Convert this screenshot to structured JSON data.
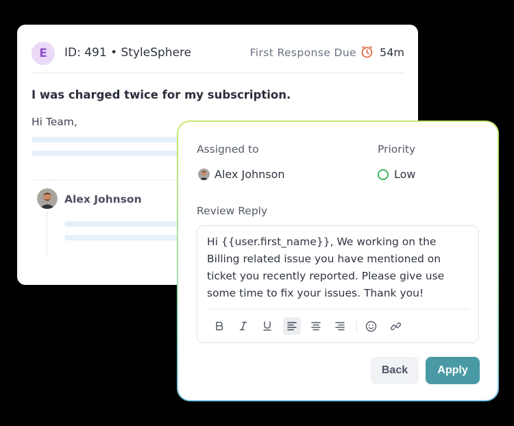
{
  "ticket": {
    "avatar_letter": "E",
    "id_label": "ID: 491 • StyleSphere",
    "first_response_label": "First Response Due",
    "first_response_time": "54m",
    "subject": "I was charged twice for my subscription.",
    "greeting": "Hi Team,",
    "reply_author": "Alex Johnson",
    "colors": {
      "avatar_bg": "#ead9f7",
      "avatar_fg": "#8e52c9",
      "timer": "#e0603a"
    }
  },
  "panel": {
    "assigned_label": "Assigned to",
    "assignee": "Alex Johnson",
    "priority_label": "Priority",
    "priority_value": "Low",
    "review_label": "Review Reply",
    "reply_text": "Hi {{user.first_name}}, We working on the Billing related issue you have mentioned on ticket you recently reported. Please give use some time to fix your issues. Thank you!",
    "toolbar": [
      "bold-icon",
      "italic-icon",
      "underline-icon",
      "align-left-icon",
      "align-center-icon",
      "align-right-icon",
      "emoji-icon",
      "link-icon"
    ],
    "active_tool": "align-left-icon",
    "back_label": "Back",
    "apply_label": "Apply",
    "colors": {
      "apply": "#4a9aa5",
      "priority_low": "#3fb45a",
      "border_gradient": [
        "#c6e668",
        "#7ec8e6"
      ]
    }
  }
}
